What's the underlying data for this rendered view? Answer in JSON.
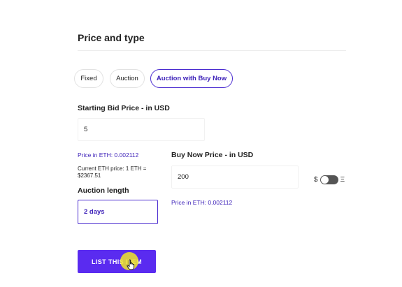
{
  "section": {
    "title": "Price and type"
  },
  "type_tabs": [
    {
      "label": "Fixed",
      "active": false
    },
    {
      "label": "Auction",
      "active": false
    },
    {
      "label": "Auction with Buy Now",
      "active": true
    }
  ],
  "starting_bid": {
    "label": "Starting Bid Price - in USD",
    "value": "5",
    "eth_price": "Price in ETH: 0.002112"
  },
  "current_eth": {
    "line1": "Current ETH price: 1 ETH =",
    "line2": "$2367.51"
  },
  "buy_now": {
    "label": "Buy Now Price - in USD",
    "value": "200",
    "eth_price": "Price in ETH: 0.002112"
  },
  "currency_toggle": {
    "left_symbol": "$",
    "right_symbol": "Ξ",
    "state": "usd"
  },
  "auction_length": {
    "label": "Auction length",
    "value": "2 days"
  },
  "list_button": {
    "label": "LIST THIS ITEM"
  },
  "colors": {
    "accent": "#5a2bf0",
    "accent_text": "#3b1fb8",
    "cursor_highlight": "#f0e628"
  },
  "icons": {
    "cursor": "hand-pointer-icon"
  }
}
